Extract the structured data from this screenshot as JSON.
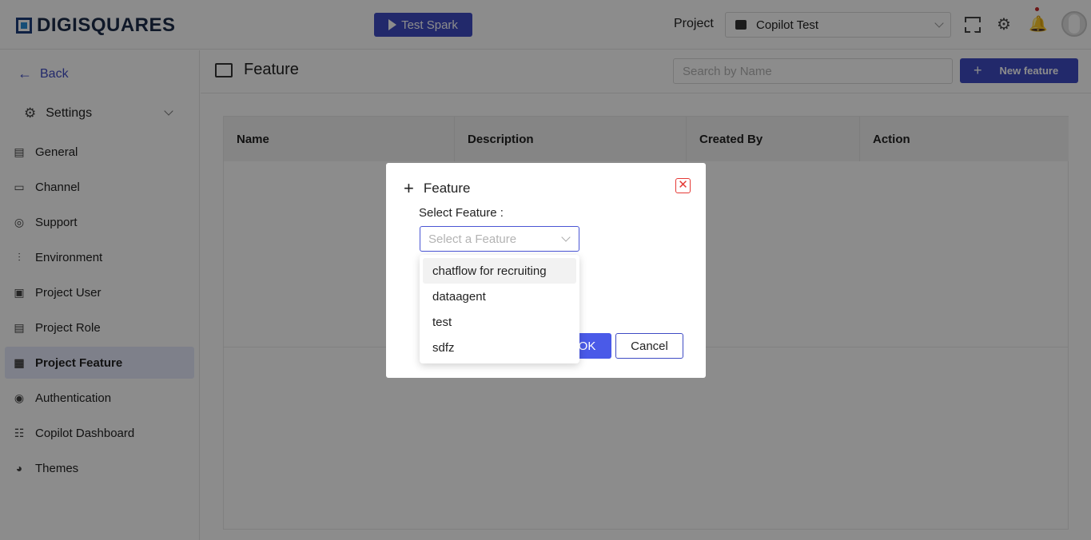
{
  "header": {
    "logo_text": "DIGISQUARES",
    "test_spark_label": "Test Spark",
    "project_label": "Project",
    "project_value": "Copilot Test",
    "icons": [
      "expand-icon",
      "gear-icon",
      "bell-icon",
      "avatar"
    ]
  },
  "sidebar": {
    "back_label": "Back",
    "settings_label": "Settings",
    "items": [
      {
        "label": "General",
        "icon": "general-icon",
        "glyph": "▤"
      },
      {
        "label": "Channel",
        "icon": "channel-icon",
        "glyph": "▭"
      },
      {
        "label": "Support",
        "icon": "support-icon",
        "glyph": "◎"
      },
      {
        "label": "Environment",
        "icon": "environment-icon",
        "glyph": "⫶"
      },
      {
        "label": "Project User",
        "icon": "project-user-icon",
        "glyph": "▣"
      },
      {
        "label": "Project Role",
        "icon": "project-role-icon",
        "glyph": "▤"
      },
      {
        "label": "Project Feature",
        "icon": "project-feature-icon",
        "glyph": "▦"
      },
      {
        "label": "Authentication",
        "icon": "authentication-icon",
        "glyph": "◉"
      },
      {
        "label": "Copilot Dashboard",
        "icon": "copilot-dashboard-icon",
        "glyph": "☷"
      },
      {
        "label": "Themes",
        "icon": "themes-icon",
        "glyph": "◕"
      }
    ],
    "active_index": 6
  },
  "main": {
    "page_title": "Feature",
    "search_placeholder": "Search by Name",
    "new_feature_label": "New feature",
    "table_headers": [
      "Name",
      "Description",
      "Created By",
      "Action"
    ]
  },
  "modal": {
    "title": "Feature",
    "select_label": "Select Feature :",
    "select_placeholder": "Select a Feature",
    "ok_label": "OK",
    "cancel_label": "Cancel",
    "options": [
      "chatflow for recruiting",
      "dataagent",
      "test",
      "sdfz"
    ],
    "hovered_option": 0
  },
  "colors": {
    "primary": "#3f4bc4",
    "danger": "#e53935",
    "active_bg": "#e6e9fb"
  }
}
